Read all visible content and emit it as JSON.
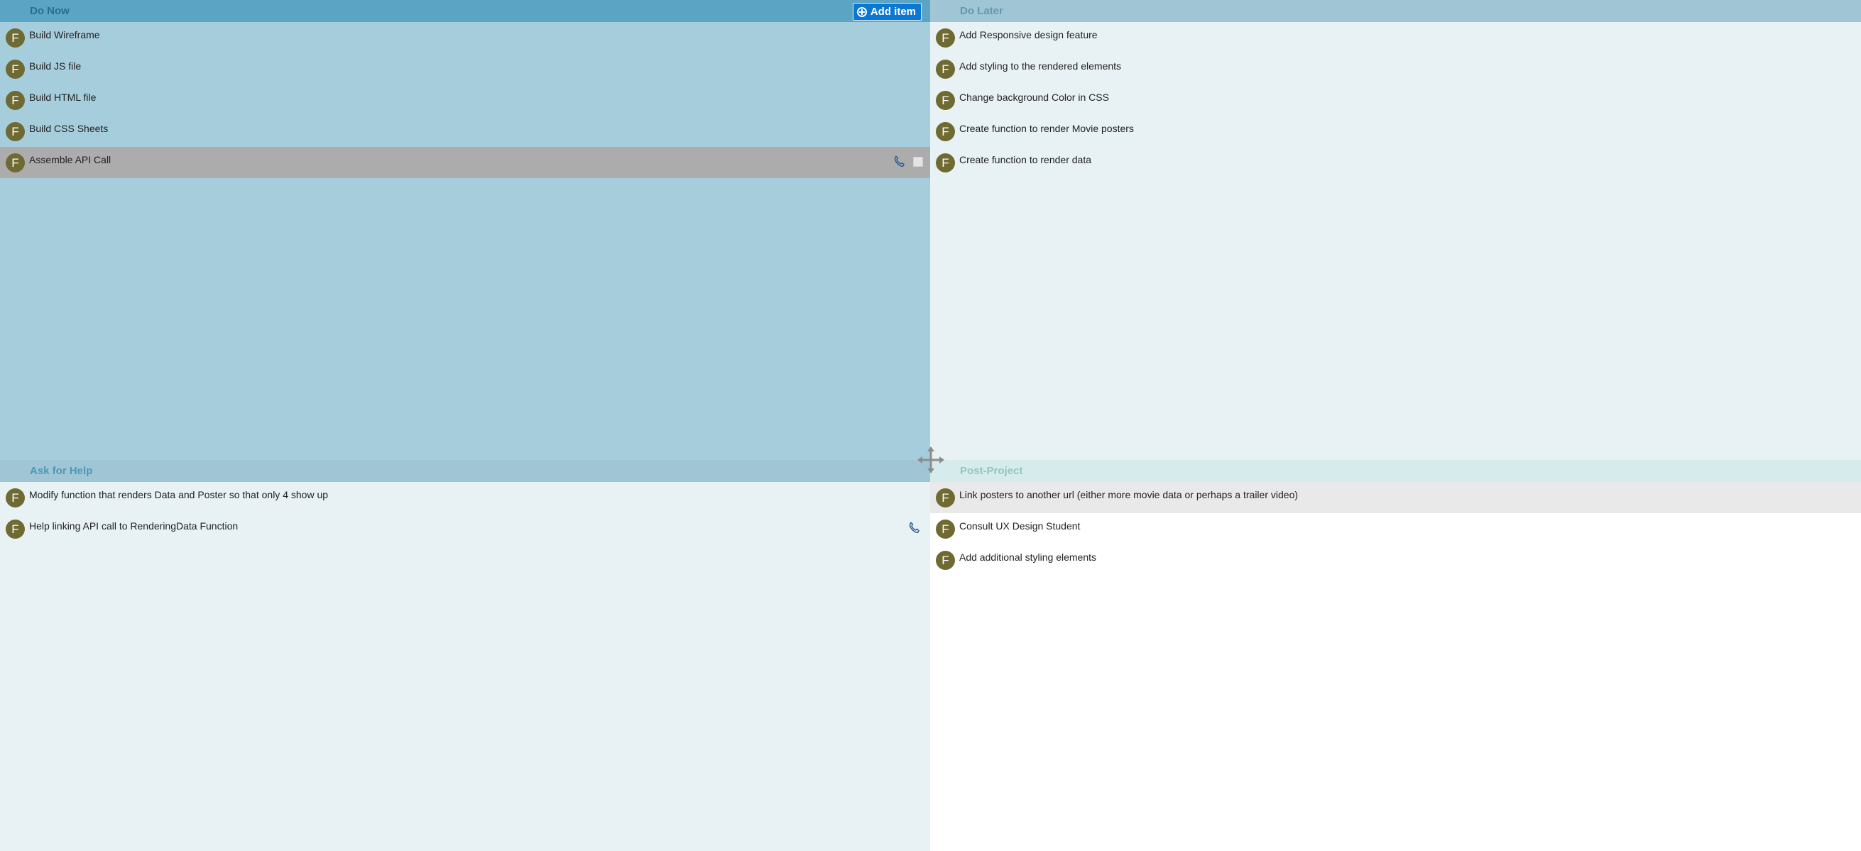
{
  "quadrants": {
    "do_now": {
      "title": "Do Now",
      "add_button_label": "Add item",
      "tasks": [
        {
          "avatar": "F",
          "label": "Build Wireframe"
        },
        {
          "avatar": "F",
          "label": "Build JS file"
        },
        {
          "avatar": "F",
          "label": "Build HTML file"
        },
        {
          "avatar": "F",
          "label": "Build CSS Sheets"
        },
        {
          "avatar": "F",
          "label": "Assemble API Call"
        }
      ]
    },
    "do_later": {
      "title": "Do Later",
      "tasks": [
        {
          "avatar": "F",
          "label": "Add Responsive design feature"
        },
        {
          "avatar": "F",
          "label": "Add styling to the rendered elements"
        },
        {
          "avatar": "F",
          "label": "Change background Color in CSS"
        },
        {
          "avatar": "F",
          "label": "Create function to render Movie posters"
        },
        {
          "avatar": "F",
          "label": "Create function to render data"
        }
      ]
    },
    "ask_for_help": {
      "title": "Ask for Help",
      "tasks": [
        {
          "avatar": "F",
          "label": "Modify function that renders Data and Poster so that only 4 show up"
        },
        {
          "avatar": "F",
          "label": "Help linking API call to RenderingData Function"
        }
      ]
    },
    "post_project": {
      "title": "Post-Project",
      "tasks": [
        {
          "avatar": "F",
          "label": "Link posters to another url (either more movie data or perhaps a trailer video)"
        },
        {
          "avatar": "F",
          "label": "Consult UX Design Student"
        },
        {
          "avatar": "F",
          "label": "Add additional styling elements"
        }
      ]
    }
  },
  "icons": {
    "add": "plus-circle-icon",
    "phone": "phone-icon",
    "move": "move-arrows-icon"
  },
  "colors": {
    "do_now_bg": "#a6cddc",
    "do_later_bg": "#e8f1f4",
    "ask_for_help_bg": "#e8f1f4",
    "post_project_bg": "#ffffff",
    "avatar": "#6e6a32",
    "accent_button": "#0a78d2",
    "selected_row": "#acacac"
  }
}
